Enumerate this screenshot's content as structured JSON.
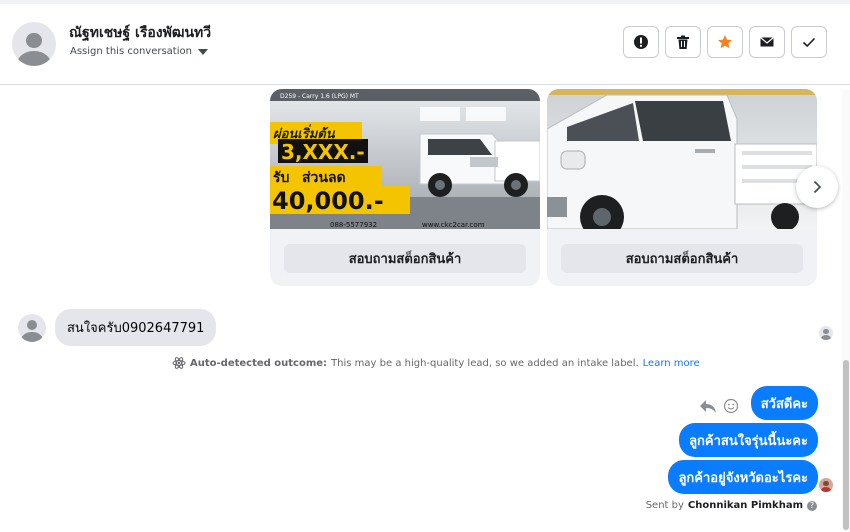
{
  "header": {
    "name": "ณัฐทเชษฐ์ เรืองพัฒนทวี",
    "assign_label": "Assign this conversation",
    "actions": [
      {
        "name": "spam-icon"
      },
      {
        "name": "trash-icon"
      },
      {
        "name": "star-icon",
        "color": "#f5841f"
      },
      {
        "name": "envelope-icon"
      },
      {
        "name": "check-icon"
      }
    ]
  },
  "carousel": {
    "cards": [
      {
        "button": "สอบถามสต็อกสินค้า",
        "image_text": {
          "top_caption": "D259 - Carry 1.6 (LPG) MT",
          "promo1": "ผ่อนเริ่มต้น",
          "promo_amount": "3,XXX.-",
          "promo2": "รับ",
          "promo3": "ส่วนลด",
          "discount": "40,000.-",
          "phone": "088-5577932",
          "website": "www.ckc2car.com"
        }
      },
      {
        "button": "สอบถามสต็อกสินค้า"
      }
    ]
  },
  "incoming": {
    "text": "สนใจครับ0902647791"
  },
  "notice": {
    "label": "Auto-detected outcome:",
    "text": "This may be a high-quality lead, so we added an intake label.",
    "link": "Learn more"
  },
  "outgoing": [
    {
      "text": "สวัสดีคะ"
    },
    {
      "text": "ลูกค้าสนใจรุ่นนี้นะคะ"
    },
    {
      "text": "ลูกค้าอยู่จังหวัดอะไรคะ"
    }
  ],
  "sent_by": {
    "prefix": "Sent by",
    "name": "Chonnikan Pimkham"
  },
  "colors": {
    "accent": "#0a7cff",
    "link": "#1877f2",
    "star": "#f5841f"
  }
}
